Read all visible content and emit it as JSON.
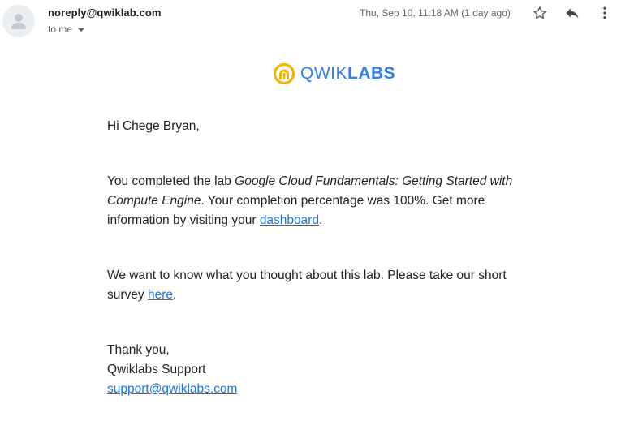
{
  "email": {
    "sender": "noreply@qwiklab.com",
    "recipient_label": "to me",
    "date": "Thu, Sep 10, 11:18 AM (1 day ago)"
  },
  "actions": {
    "star_icon": "star-outline-icon",
    "reply_icon": "reply-icon",
    "more_icon": "more-vertical-icon"
  },
  "logo": {
    "prefix": "QWIK",
    "suffix": "LABS",
    "colors": {
      "mark": "#f5b400",
      "text": "#2f80ed"
    }
  },
  "message": {
    "greeting": "Hi Chege Bryan,",
    "p1_before": "You completed the lab ",
    "p1_lab_name": "Google Cloud Fundamentals: Getting Started with Compute Engine",
    "p1_middle": ". Your completion percentage was 100%. Get more information by visiting your ",
    "p1_link": "dashboard",
    "p1_end": ".",
    "p2_before": "We want to know what you thought about this lab. Please take our short survey ",
    "p2_link": "here",
    "p2_end": ".",
    "thanks": "Thank you,",
    "signature": "Qwiklabs Support",
    "support_email": "support@qwiklabs.com"
  },
  "colors": {
    "link": "#1a73e8",
    "text": "#222222",
    "muted": "#5f6368"
  }
}
